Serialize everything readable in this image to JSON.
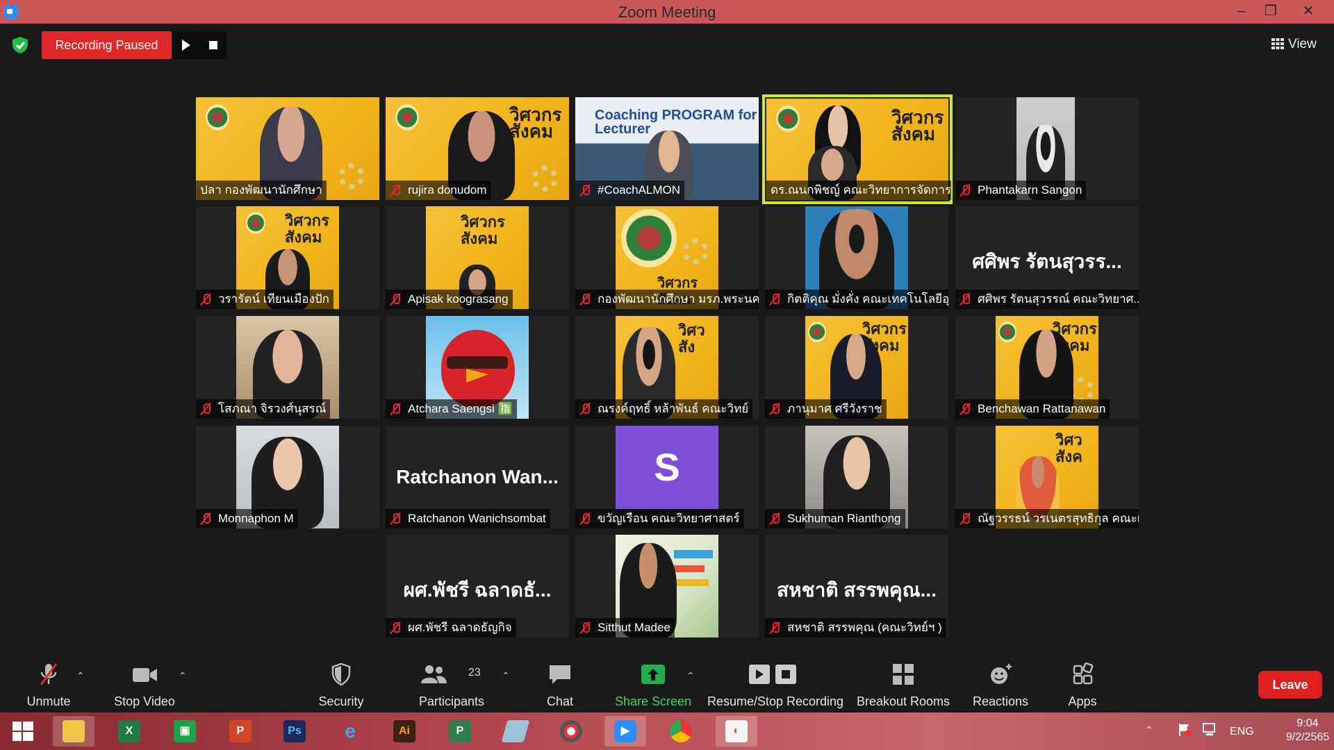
{
  "window": {
    "title": "Zoom Meeting"
  },
  "topbar": {
    "recording_label": "Recording Paused",
    "view_label": "View"
  },
  "tiles": [
    {
      "name": "ปลา กองพัฒนานักศึกษา"
    },
    {
      "name": "rujira donudom"
    },
    {
      "name": "#CoachALMON",
      "banner_text": "Coaching PROGRAM for Lecturer"
    },
    {
      "name": "ดร.ณนกพิชญ์ คณะวิทยาการจัดการ"
    },
    {
      "name": "Phantakarn Sangon"
    },
    {
      "name": "วรารัตน์ เทียนเมืองปัก"
    },
    {
      "name": "Apisak koograsang"
    },
    {
      "name": "กองพัฒนานักศึกษา มรภ.พระนคร"
    },
    {
      "name": "กิตติคุณ มั่งคั่ง คณะเทคโนโลยีอุ..."
    },
    {
      "name": "ศศิพร รัตนสุวรรณ์ คณะวิทยาศ...",
      "big": "ศศิพร รัตนสุวรร..."
    },
    {
      "name": "โสภณา จิรวงศ์นุสรณ์"
    },
    {
      "name": "Atchara Saengsi 🈯"
    },
    {
      "name": "ณรงค์ฤทธิ์ หล้าพันธ์ คณะวิทย์"
    },
    {
      "name": "ภานุมาศ ศรีวังราช"
    },
    {
      "name": "Benchawan Rattanawan"
    },
    {
      "name": "Monnaphon M"
    },
    {
      "name": "Ratchanon Wanichsombat",
      "big": "Ratchanon  Wan..."
    },
    {
      "name": "ขวัญเรือน คณะวิทยาศาสตร์",
      "initial": "S"
    },
    {
      "name": "Sukhuman Rianthong"
    },
    {
      "name": "ณัฐวรรธน์ วรเนตรสุทธิกุล คณะเ..."
    },
    {
      "name": "ผศ.พัชรี ฉลาดธัญกิจ",
      "big": "ผศ.พัชรี  ฉลาดธั..."
    },
    {
      "name": "Sitthut Madee"
    },
    {
      "name": "สหชาติ สรรพคุณ (คณะวิทย์ฯ )",
      "big": "สหชาติ  สรรพคุณ..."
    }
  ],
  "toolbar": {
    "unmute": "Unmute",
    "stop_video": "Stop Video",
    "security": "Security",
    "participants": "Participants",
    "participants_count": "23",
    "chat": "Chat",
    "share_screen": "Share Screen",
    "recording": "Resume/Stop Recording",
    "breakout": "Breakout Rooms",
    "reactions": "Reactions",
    "apps": "Apps",
    "leave": "Leave"
  },
  "taskbar": {
    "lang": "ENG",
    "time": "9:04",
    "date": "9/2/2565"
  },
  "colors": {
    "titlebar": "#c9585b",
    "recording": "#e02828",
    "active_speaker": "#cde73a",
    "share": "#3fd36b",
    "leave": "#e02020"
  }
}
